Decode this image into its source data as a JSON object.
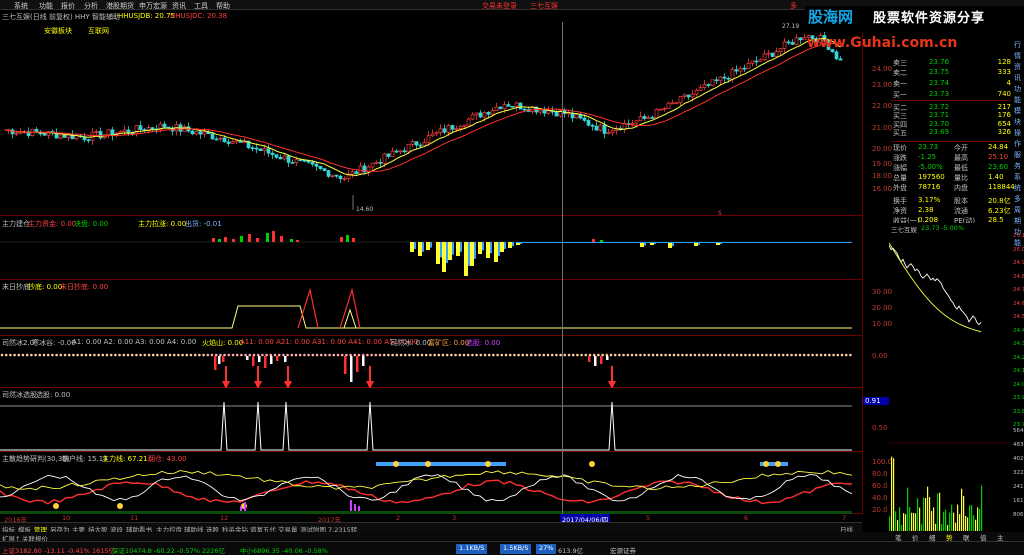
{
  "menu": {
    "items": [
      "系统",
      "功能",
      "报价",
      "分析",
      "港股期货",
      "申万宏源",
      "资讯",
      "工具",
      "帮助"
    ],
    "center_red": "交易未登录",
    "center_right": "三七互娱",
    "right_partial": "多"
  },
  "brand": {
    "logo": "股海网",
    "slogan": "股票软件资源分享",
    "url": "www.Guhai.com.cn"
  },
  "main_chart": {
    "title": "三七互娱(日线 前复权) HHY 智能辅助",
    "hhusjdb": "HHUSJDB: 20.75",
    "hhusjdc": "HHUSJDC: 20.38",
    "sub1": "安徽板块",
    "sub2": "互联网",
    "high_label": "27.19",
    "low_label": "14.60",
    "price_ticks": [
      "24.00",
      "23.00",
      "22.00",
      "21.00",
      "20.00",
      "19.00",
      "18.00",
      "17.00",
      "16.00"
    ]
  },
  "panes": {
    "p2": {
      "name": "主力建仓",
      "a": "主力资金: 0.00",
      "b": "决盘: 0.00",
      "c": "主力拉涨: 0.00",
      "d": "出货: -0.01"
    },
    "p3": {
      "name": "末日抄底",
      "a": "抄底: 0.00",
      "b": "末日抄底: 0.00",
      "ticks": [
        "30.00",
        "20.00",
        "10.00"
      ]
    },
    "p4": {
      "name": "司然冰2.0",
      "a": "寒冰谷: -0.00",
      "b": "A1: 0.00 A2: 0.00 A3: 0.00 A4: 0.00",
      "c": "火焰山: 0.00",
      "d": "A11: 0.00 A21: 0.00 A31: 0.00 A41: 0.00 A51: 0.00",
      "e": "司然冰: 0.00",
      "f": "富矿区: 0.00",
      "g": "选股: 0.00",
      "tick": "0.00"
    },
    "p5": {
      "name": "司然冰选股",
      "a": "选股: 0.00",
      "value_box": "0.91",
      "tick": "0.50"
    },
    "p6": {
      "name": "主散趋势研判(30,30)",
      "a": "散户线: 15.19",
      "b": "主力线: 67.21",
      "c": "翻仓: 43.00",
      "ticks": [
        "100.0",
        "80.0",
        "60.0",
        "40.0",
        "20.0"
      ]
    }
  },
  "date_axis": [
    "2016年",
    "10",
    "11",
    "12",
    "2017年",
    "2",
    "3",
    "2017/04/06/四",
    "5",
    "6",
    "7"
  ],
  "tabs": [
    "指标",
    "模板",
    "管理",
    "另存为",
    "主要",
    "持大股",
    "波段",
    "辅助看书",
    "主力控盘",
    "辅助线",
    "选股",
    "秒杀金钻",
    "谱富五代",
    "交易量",
    "测试附图",
    "7.2315转"
  ],
  "tab_bottom": [
    "扩展↑",
    "关联报价"
  ],
  "tab_right": "日线",
  "quote": {
    "sell": [
      {
        "label": "卖三",
        "price": "23.76",
        "vol": "128"
      },
      {
        "label": "卖二",
        "price": "23.75",
        "vol": "333"
      },
      {
        "label": "卖一",
        "price": "23.74",
        "vol": "4"
      },
      {
        "label": "买一",
        "price": "23.73",
        "vol": "740"
      },
      {
        "label": "买二",
        "price": "23.72",
        "vol": "217"
      },
      {
        "label": "买三",
        "price": "23.71",
        "vol": "176"
      },
      {
        "label": "买四",
        "price": "23.70",
        "vol": "654"
      },
      {
        "label": "买五",
        "price": "23.69",
        "vol": "326"
      }
    ],
    "stats": [
      {
        "l1": "现价",
        "v1": "23.73",
        "l2": "今开",
        "v2": "24.84"
      },
      {
        "l1": "涨跌",
        "v1": "-1.25",
        "l2": "最高",
        "v2": "25.10"
      },
      {
        "l1": "涨幅",
        "v1": "-5.00%",
        "l2": "最低",
        "v2": "23.60"
      },
      {
        "l1": "总量",
        "v1": "197560",
        "l2": "量比",
        "v2": "1.40"
      },
      {
        "l1": "外盘",
        "v1": "78716",
        "l2": "内盘",
        "v2": "118844"
      },
      {
        "l1": "换手",
        "v1": "3.17%",
        "l2": "股本",
        "v2": "20.8亿"
      },
      {
        "l1": "净资",
        "v1": "2.38",
        "l2": "流通",
        "v2": "6.23亿"
      },
      {
        "l1": "收益(一)",
        "v1": "0.208",
        "l2": "PE(动)",
        "v2": "28.5"
      }
    ],
    "mini_title": "三七互娱",
    "mini_price": "23.73",
    "mini_pct": "-5.00%",
    "mini_ticks": [
      "25.10",
      "25.00",
      "24.90",
      "24.80",
      "24.70",
      "24.60",
      "24.50",
      "24.40",
      "24.30",
      "24.20",
      "24.10",
      "24.00",
      "23.90",
      "23.80",
      "23.70"
    ],
    "vol_ticks": [
      "5640",
      "4834",
      "4028",
      "3222",
      "2417",
      "1611",
      "806"
    ],
    "bottom_tabs": [
      "笔",
      "价",
      "细",
      "势",
      "联",
      "值",
      "主"
    ]
  },
  "sidebar": [
    "行",
    "情",
    "资",
    "讯",
    "功",
    "能",
    "模",
    "块",
    "操",
    "作",
    "服",
    "务",
    "系",
    "统",
    "多",
    "周",
    "期",
    "功",
    "能"
  ],
  "status": {
    "sh": "上证3182.80 -13.11 -0.41% 1615亿",
    "sz": "深证10474.8 -60.22 -0.57% 2226亿",
    "zx": "中小6896.35 -40.06 -0.58%",
    "net1": "1.1KB/S",
    "net2": "1.5KB/S",
    "pct": "27%",
    "time": "613.9亿",
    "broker": "宏源证券"
  }
}
